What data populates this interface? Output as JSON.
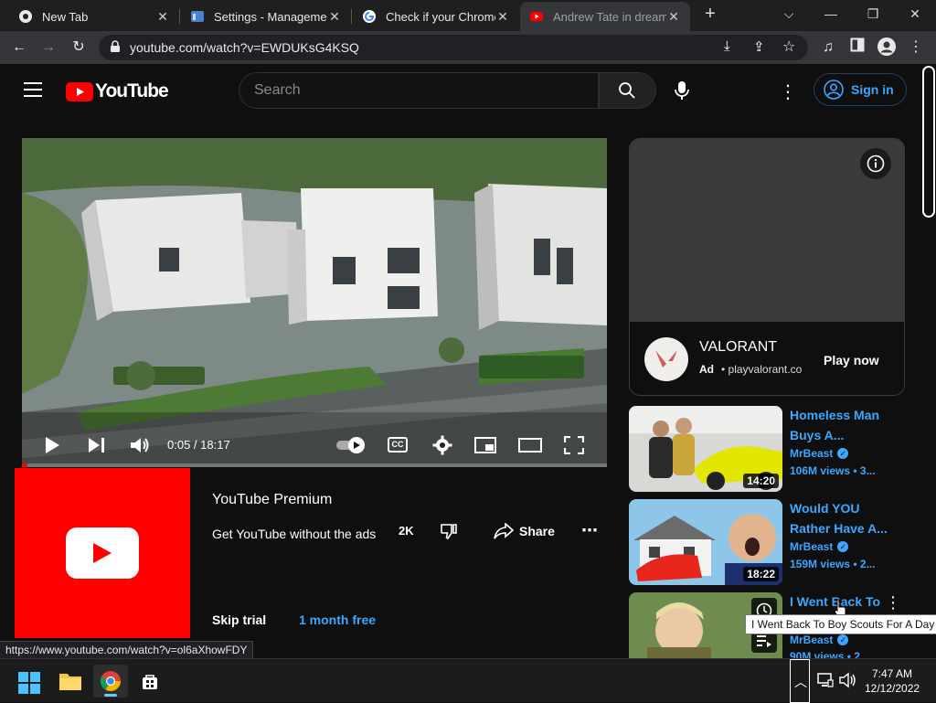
{
  "browser": {
    "tabs": [
      {
        "title": "New Tab",
        "icon": "chrome-icon"
      },
      {
        "title": "Settings - Management",
        "icon": "settings-page-icon"
      },
      {
        "title": "Check if your Chrome b",
        "icon": "google-icon"
      },
      {
        "title": "Andrew Tate in dream A",
        "icon": "youtube-icon",
        "active": true
      }
    ],
    "new_tab_label": "+",
    "url": "youtube.com/watch?v=EWDUKsG4KSQ"
  },
  "youtube": {
    "logo_text": "YouTube",
    "search_placeholder": "Search",
    "sign_in_label": "Sign in",
    "accent": "#3ea6ff",
    "brand_red": "#ff0000"
  },
  "player": {
    "time_current": "0:05",
    "time_total": "18:17",
    "time_display": "0:05 / 18:17",
    "cc_label": "CC",
    "progress": 0.005
  },
  "ad": {
    "brand": "VALORANT",
    "ad_badge": "Ad",
    "domain": "playvalorant.co",
    "cta": "Play now"
  },
  "premium": {
    "title": "YouTube Premium",
    "subtitle": "Get YouTube without the ads",
    "likes": "2K",
    "share_label": "Share",
    "skip_label": "Skip trial",
    "cta_label": "1 month free"
  },
  "related": [
    {
      "title": "Homeless Man Buys A...",
      "channel": "MrBeast",
      "meta": "106M views • 3...",
      "duration": "14:20"
    },
    {
      "title": "Would YOU Rather Have A...",
      "channel": "MrBeast",
      "meta": "159M views • 2...",
      "duration": "18:22"
    },
    {
      "title": "I Went Back To",
      "channel": "MrBeast",
      "meta": "90M views • 2",
      "duration": ""
    }
  ],
  "tooltip": "I Went Back To Boy Scouts For A Day",
  "status_url": "https://www.youtube.com/watch?v=ol6aXhowFDY",
  "taskbar": {
    "time": "7:47 AM",
    "date": "12/12/2022"
  }
}
